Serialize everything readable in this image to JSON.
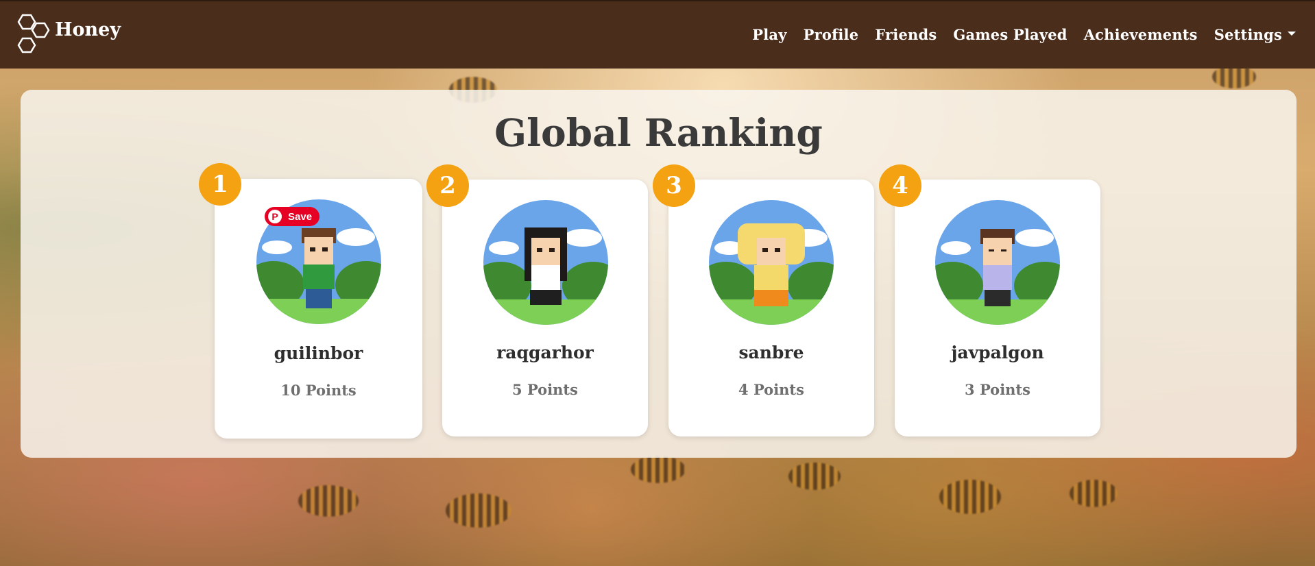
{
  "brand": {
    "name": "Honey",
    "icon": "honeycomb-icon"
  },
  "nav": {
    "play": "Play",
    "profile": "Profile",
    "friends": "Friends",
    "games_played": "Games Played",
    "achievements": "Achievements",
    "settings": "Settings"
  },
  "page": {
    "title": "Global Ranking"
  },
  "pinterest": {
    "save_label": "Save",
    "icon": "pinterest-icon"
  },
  "ranking": [
    {
      "rank": "1",
      "username": "guilinbor",
      "points": "10 Points",
      "avatar_shirt": "#2f9a3e",
      "avatar_hair": "#6b3f22",
      "avatar_pants": "#2c5b96"
    },
    {
      "rank": "2",
      "username": "raqgarhor",
      "points": "5 Points",
      "avatar_shirt": "#ffffff",
      "avatar_hair": "#1f1a1a",
      "avatar_pants": "#1f1f1f"
    },
    {
      "rank": "3",
      "username": "sanbre",
      "points": "4 Points",
      "avatar_shirt": "#f3d96a",
      "avatar_hair": "#f5d86e",
      "avatar_pants": "#f08a1c"
    },
    {
      "rank": "4",
      "username": "javpalgon",
      "points": "3 Points",
      "avatar_shirt": "#b9b4ea",
      "avatar_hair": "#5a3420",
      "avatar_pants": "#2b2b2b"
    }
  ],
  "colors": {
    "navbar": "#4b2d1c",
    "badge": "#f4a212",
    "pinterest": "#e60023"
  }
}
